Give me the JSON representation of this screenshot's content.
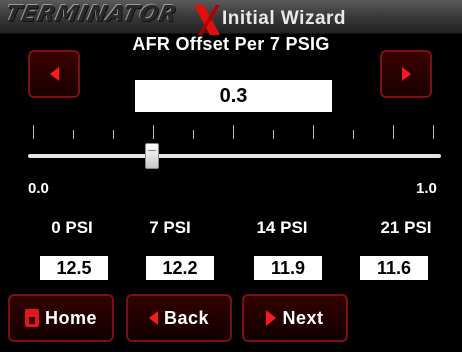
{
  "header": {
    "brand": "TERMINATOR",
    "title": "Initial Wizard"
  },
  "parameter": {
    "title": "AFR Offset Per 7 PSIG",
    "value": "0.3",
    "slider_min": "0.0",
    "slider_max": "1.0",
    "slider_level": 0.3
  },
  "psi_columns": [
    {
      "label": "0 PSI",
      "value": "12.5"
    },
    {
      "label": "7 PSI",
      "value": "12.2"
    },
    {
      "label": "14 PSI",
      "value": "11.9"
    },
    {
      "label": "21 PSI",
      "value": "11.6"
    }
  ],
  "nav": {
    "home": "Home",
    "back": "Back",
    "next": "Next"
  },
  "colors": {
    "accent": "#ff1a1a",
    "button_border": "#7a1010",
    "background": "#000000"
  },
  "icons": {
    "decrease": "left-arrow-icon",
    "increase": "right-arrow-icon",
    "home": "home-icon",
    "back": "back-arrow-icon",
    "next": "next-arrow-icon",
    "brand_mark": "x-logo-icon"
  }
}
